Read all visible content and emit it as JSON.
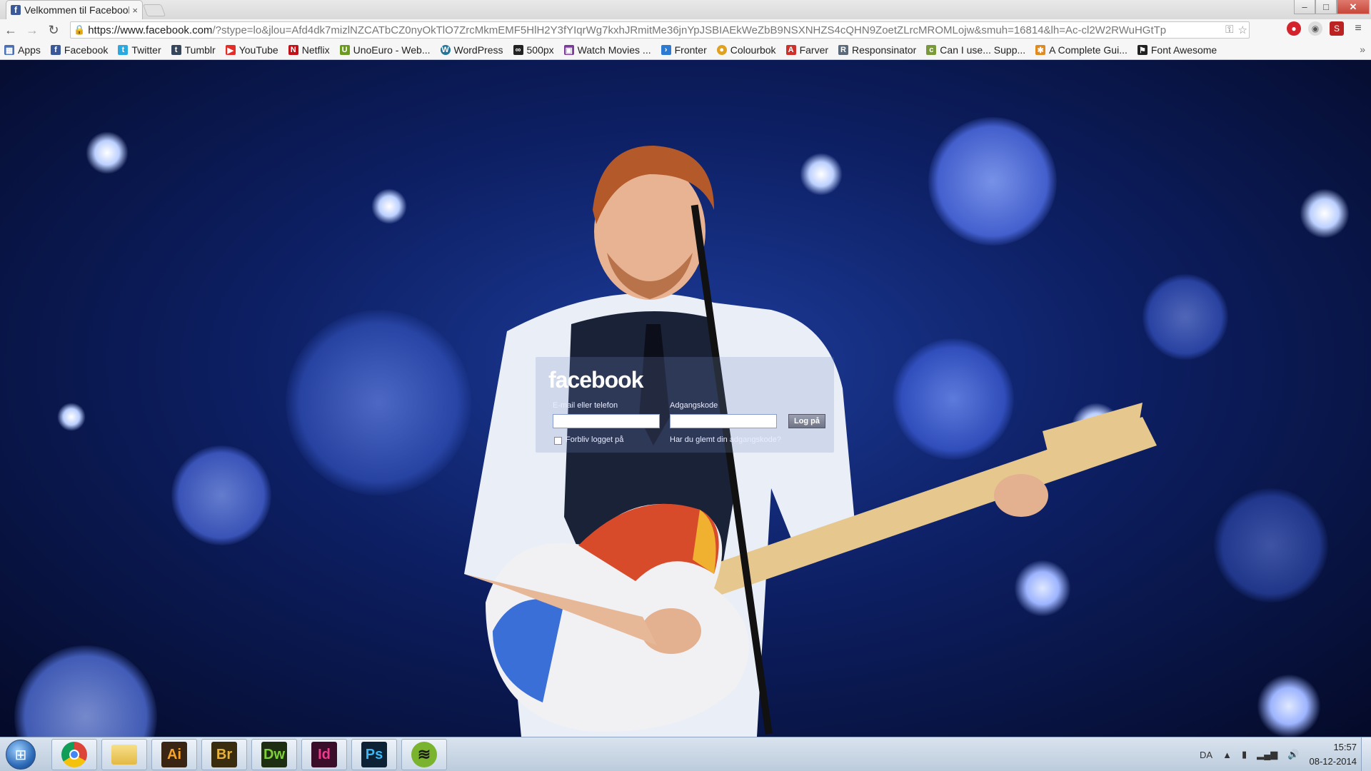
{
  "browser": {
    "tab_title": "Velkommen til Facebook",
    "tab_close": "×",
    "window_controls": [
      "–",
      "□",
      "✕"
    ],
    "url_host": "https://www.facebook.com",
    "url_rest": "/?stype=lo&jlou=Afd4dk7mizlNZCATbCZ0nyOkTlO7ZrcMkmEMF5HlH2Y3fYIqrWg7kxhJRmitMe36jnYpJSBIAEkWeZbB9NSXNHZS4cQHN9ZoetZLrcMROMLojw&smuh=16814&lh=Ac-cl2W2RWuHGtTp"
  },
  "bookmarks": [
    {
      "label": "Apps",
      "icon": "apps-grid-icon",
      "color": "#4a6fb5"
    },
    {
      "label": "Facebook",
      "icon": "facebook-icon",
      "color": "#3b5998"
    },
    {
      "label": "Twitter",
      "icon": "twitter-icon",
      "color": "#2aa9e0"
    },
    {
      "label": "Tumblr",
      "icon": "tumblr-icon",
      "color": "#35465c"
    },
    {
      "label": "YouTube",
      "icon": "youtube-icon",
      "color": "#e52d27"
    },
    {
      "label": "Netflix",
      "icon": "netflix-icon",
      "color": "#c11119"
    },
    {
      "label": "UnoEuro - Web...",
      "icon": "unoeuro-icon",
      "color": "#6a9a1f"
    },
    {
      "label": "WordPress",
      "icon": "wordpress-icon",
      "color": "#21759b"
    },
    {
      "label": "500px",
      "icon": "500px-icon",
      "color": "#222222"
    },
    {
      "label": "Watch Movies ...",
      "icon": "movies-icon",
      "color": "#7a3b9a"
    },
    {
      "label": "Fronter",
      "icon": "fronter-icon",
      "color": "#2c7bd0"
    },
    {
      "label": "Colourbok",
      "icon": "colourbok-icon",
      "color": "#e0a020"
    },
    {
      "label": "Farver",
      "icon": "farver-icon",
      "color": "#d0302a"
    },
    {
      "label": "Responsinator",
      "icon": "responsinator-icon",
      "color": "#5a6a7a"
    },
    {
      "label": "Can I use... Supp...",
      "icon": "caniuse-icon",
      "color": "#7a9a3a"
    },
    {
      "label": "A Complete Gui...",
      "icon": "css-tricks-icon",
      "color": "#e08a20"
    },
    {
      "label": "Font Awesome",
      "icon": "font-awesome-icon",
      "color": "#222222"
    }
  ],
  "bookmarks_more": "»",
  "login": {
    "logo": "facebook",
    "email_label": "E-mail eller telefon",
    "password_label": "Adgangskode",
    "login_button": "Log på",
    "remember_label": "Forbliv logget på",
    "forgot_link": "Har du glemt din adgangskode?"
  },
  "taskbar": {
    "apps": [
      {
        "name": "chrome",
        "label": ""
      },
      {
        "name": "explorer",
        "label": ""
      },
      {
        "name": "illustrator",
        "label": "Ai"
      },
      {
        "name": "bridge",
        "label": "Br"
      },
      {
        "name": "dreamweaver",
        "label": "Dw"
      },
      {
        "name": "indesign",
        "label": "Id"
      },
      {
        "name": "photoshop",
        "label": "Ps"
      },
      {
        "name": "spotify",
        "label": ""
      }
    ],
    "language": "DA",
    "time": "15:57",
    "date": "08-12-2014"
  }
}
